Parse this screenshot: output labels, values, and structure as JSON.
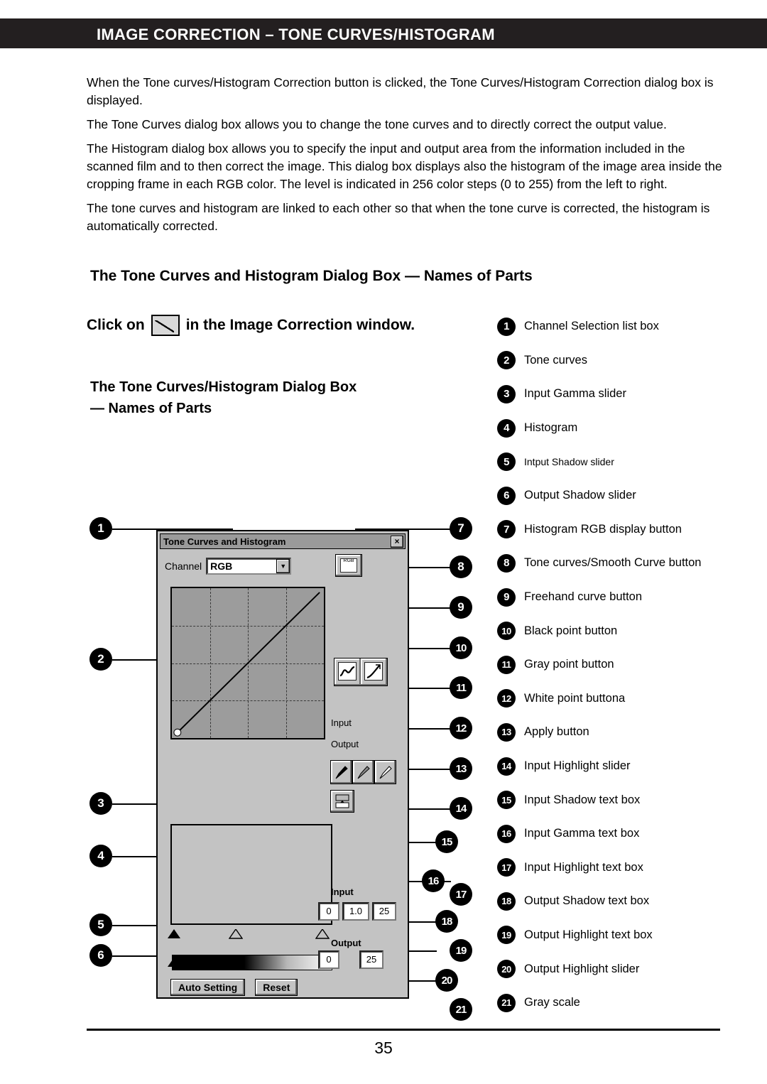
{
  "header": {
    "title": "IMAGE CORRECTION – TONE CURVES/HISTOGRAM"
  },
  "body": {
    "paragraphs": [
      "When the Tone curves/Histogram Correction button is clicked, the Tone Curves/Histogram Correction dialog box is displayed.",
      "The Tone Curves dialog box allows you to change the tone curves and to directly correct the output value.",
      "The Histogram dialog box allows you to specify the input and output area from the information included in the scanned film and to then correct the image.  This dialog box displays also the histogram of the image area inside the cropping frame in each RGB color. The level is indicated in 256 color steps (0 to 255) from the left to right.",
      "The tone curves and histogram are linked to each other so that when the tone curve is corrected, the histogram is automatically corrected."
    ]
  },
  "headings": {
    "names_of_parts": "The Tone Curves and Histogram Dialog Box  — Names of Parts",
    "click_on_prefix": "Click on",
    "click_on_suffix": "in the Image Correction window.",
    "dialog_box_heading_line1": "The Tone Curves/Histogram Dialog Box",
    "dialog_box_heading_line2": "— Names of Parts"
  },
  "legend": [
    {
      "num": "1",
      "label": "Channel Selection list box"
    },
    {
      "num": "2",
      "label": "Tone curves"
    },
    {
      "num": "3",
      "label": "Input Gamma slider"
    },
    {
      "num": "4",
      "label": "Histogram"
    },
    {
      "num": "5",
      "label": "Intput Shadow slider"
    },
    {
      "num": "6",
      "label": "Output Shadow slider"
    },
    {
      "num": "7",
      "label": "Histogram RGB display button"
    },
    {
      "num": "8",
      "label": "Tone curves/Smooth Curve button"
    },
    {
      "num": "9",
      "label": "Freehand curve button"
    },
    {
      "num": "10",
      "label": "Black point button"
    },
    {
      "num": "11",
      "label": "Gray point button"
    },
    {
      "num": "12",
      "label": "White point buttona"
    },
    {
      "num": "13",
      "label": "Apply button"
    },
    {
      "num": "14",
      "label": "Input Highlight slider"
    },
    {
      "num": "15",
      "label": "Input Shadow text box"
    },
    {
      "num": "16",
      "label": "Input Gamma text box"
    },
    {
      "num": "17",
      "label": "Input Highlight text box"
    },
    {
      "num": "18",
      "label": "Output Shadow text box"
    },
    {
      "num": "19",
      "label": "Output Highlight text box"
    },
    {
      "num": "20",
      "label": "Output Highlight slider"
    },
    {
      "num": "21",
      "label": "Gray scale"
    }
  ],
  "dialog": {
    "title": "Tone Curves and Histogram",
    "close_label": "×",
    "channel_label": "Channel",
    "channel_value": "RGB",
    "combo_arrow": "▼",
    "rgb_button_glyph": "RGB",
    "input_label_curve": "Input",
    "output_label_curve": "Output",
    "input_label": "Input",
    "output_label": "Output",
    "input_shadow_value": "0",
    "input_gamma_value": "1.0",
    "input_highlight_value": "25",
    "output_shadow_value": "0",
    "output_highlight_value": "25",
    "auto_setting_label": "Auto Setting",
    "reset_label": "Reset"
  },
  "figure_callouts": [
    "1",
    "2",
    "3",
    "4",
    "5",
    "6",
    "7",
    "8",
    "9",
    "10",
    "11",
    "12",
    "13",
    "14",
    "15",
    "16",
    "17",
    "18",
    "19",
    "20",
    "21"
  ],
  "footer": {
    "page_number": "35"
  }
}
